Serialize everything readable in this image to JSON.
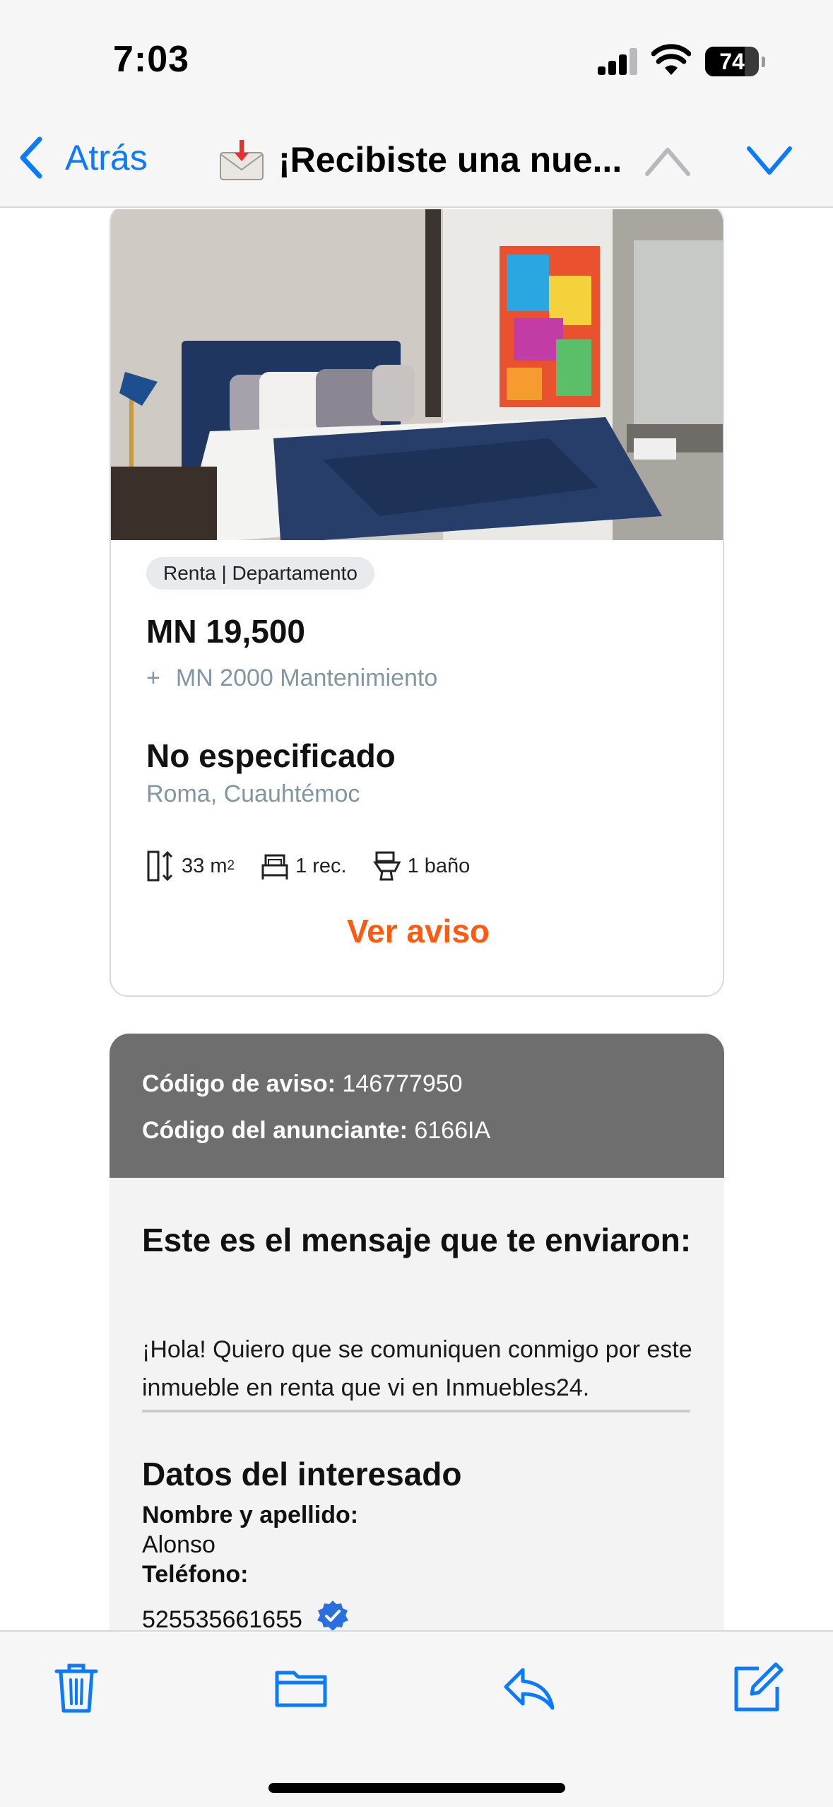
{
  "status_bar": {
    "time": "7:03",
    "battery": "74",
    "battery_level": 0.74
  },
  "nav": {
    "back_label": "Atrás",
    "title": "¡Recibiste una nue...",
    "accent_color": "#0a7aff"
  },
  "listing": {
    "tags": "Renta  |  Departamento",
    "price": "MN 19,500",
    "maintenance_plus": "+",
    "maintenance": "MN 2000 Mantenimiento",
    "address": "No especificado",
    "location": "Roma, Cuauhtémoc",
    "area": "33 m",
    "area_sup": "2",
    "rooms": "1 rec.",
    "baths": "1 baño",
    "cta": "Ver aviso",
    "cta_color": "#ff5a10"
  },
  "codes": {
    "ad_label": "Código de aviso:",
    "ad_value": "146777950",
    "advertiser_label": "Código del anunciante:",
    "advertiser_value": "6166IA"
  },
  "message": {
    "heading": "Este es el mensaje que te enviaron:",
    "text": "¡Hola! Quiero que se comuniquen conmigo por este inmueble en renta que vi en Inmuebles24."
  },
  "interested": {
    "heading": "Datos del interesado",
    "name_label": "Nombre y apellido:",
    "name_value": "Alonso",
    "phone_label": "Teléfono:",
    "phone_value": "525535661655"
  },
  "toolbar": {
    "icons": [
      "trash-icon",
      "folder-icon",
      "reply-icon",
      "compose-icon"
    ]
  }
}
